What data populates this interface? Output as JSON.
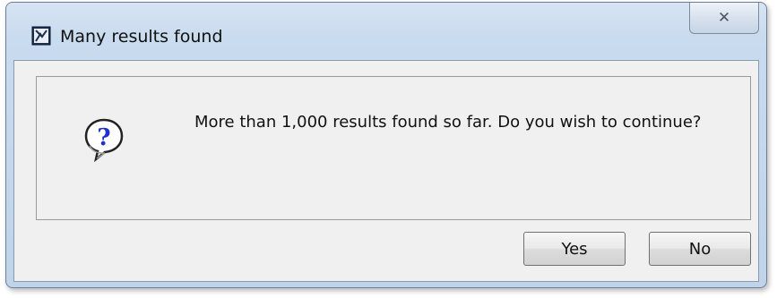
{
  "dialog": {
    "title": "Many results found",
    "close_glyph": "✕",
    "message": "More than 1,000 results found so far. Do you wish to continue?",
    "yes_label": "Yes",
    "no_label": "No",
    "app_icon": "application-icon",
    "message_icon": "question-icon"
  },
  "colors": {
    "titlebar": "#c9dbee",
    "client": "#f0f0f0",
    "question_mark": "#1f2fd0"
  }
}
